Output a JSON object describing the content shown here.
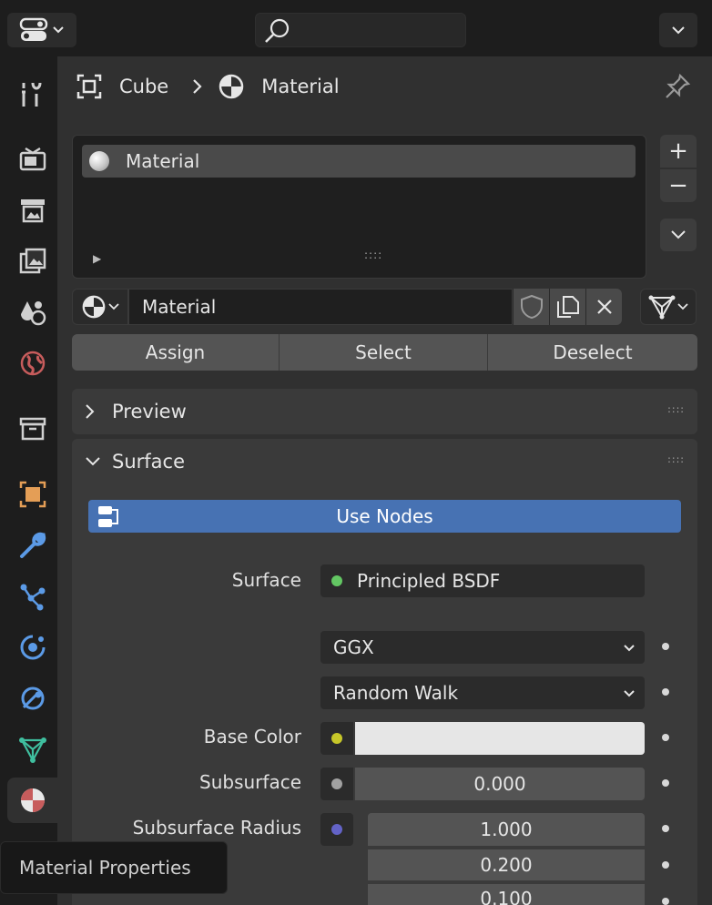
{
  "topbar": {
    "search_placeholder": ""
  },
  "breadcrumb": {
    "object": "Cube",
    "data": "Material"
  },
  "slots": {
    "items": [
      "Material"
    ]
  },
  "material": {
    "name": "Material"
  },
  "assign": {
    "assign": "Assign",
    "select": "Select",
    "deselect": "Deselect"
  },
  "preview": {
    "title": "Preview"
  },
  "surface": {
    "title": "Surface",
    "use_nodes": "Use Nodes",
    "surface_label": "Surface",
    "surface_value": "Principled BSDF",
    "distribution": "GGX",
    "subsurface_method": "Random Walk",
    "base_color_label": "Base Color",
    "base_color": "#e6e6e6",
    "subsurface_label": "Subsurface",
    "subsurface_value": "0.000",
    "subsurface_radius_label": "Subsurface Radius",
    "subsurface_radius": [
      "1.000",
      "0.200",
      "0.100"
    ]
  },
  "tooltip": {
    "text": "Material Properties"
  },
  "colors": {
    "accent": "#4772b3",
    "socket_shader": "#63c763",
    "socket_color": "#c7c729",
    "socket_float": "#a1a1a1",
    "socket_vector": "#6363c7"
  }
}
